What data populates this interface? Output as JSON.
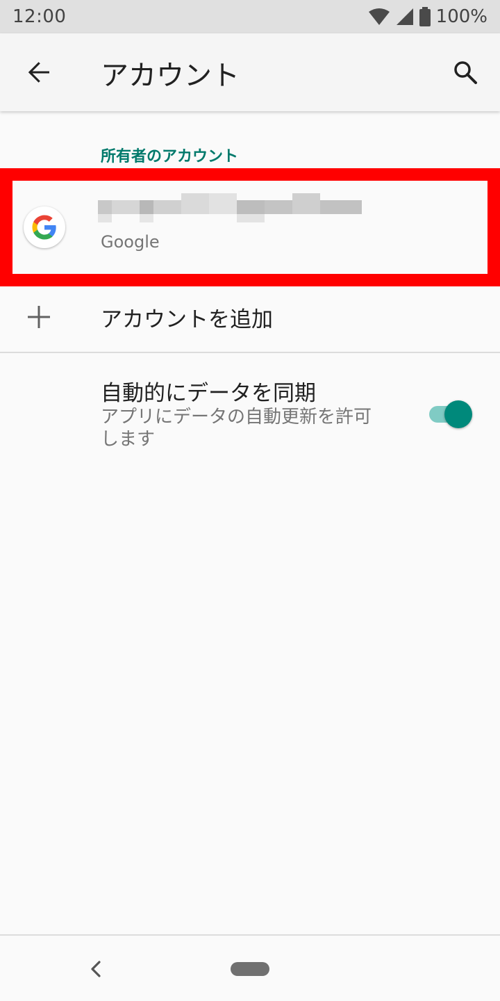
{
  "status_bar": {
    "time": "12:00",
    "battery": "100%",
    "icons": [
      "wifi-icon",
      "signal-icon",
      "battery-icon"
    ]
  },
  "app_bar": {
    "title": "アカウント",
    "back_icon": "arrow-back-icon",
    "search_icon": "search-icon"
  },
  "section": {
    "header": "所有者のアカウント"
  },
  "account": {
    "type": "Google",
    "icon": "google-logo-icon"
  },
  "add_account": {
    "label": "アカウントを追加",
    "icon": "plus-icon"
  },
  "sync": {
    "title": "自動的にデータを同期",
    "description": "アプリにデータの自動更新を許可します",
    "enabled": true
  },
  "nav_bar": {
    "back_icon": "chevron-left-icon",
    "home_icon": "home-pill-icon"
  },
  "colors": {
    "accent": "#00796b",
    "toggle_thumb": "#00897b",
    "toggle_track": "#80cbc4",
    "highlight": "#ff0000"
  }
}
